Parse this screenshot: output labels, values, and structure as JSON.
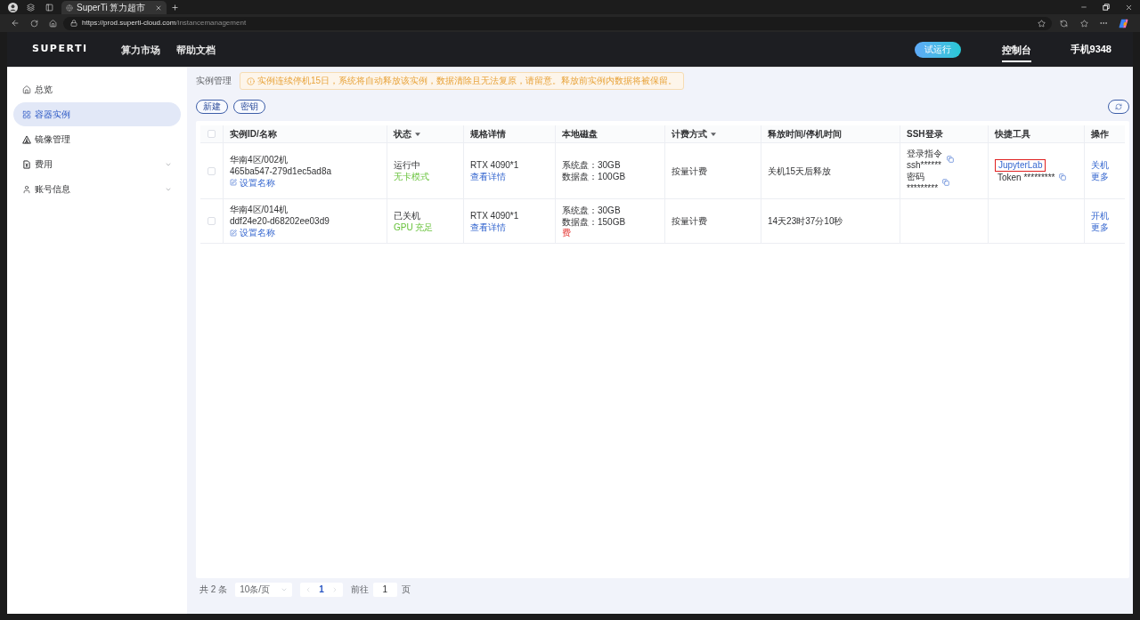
{
  "browser": {
    "tab_title": "SuperTi 算力超市",
    "url_host": "https://prod.superti-cloud.com",
    "url_path": "/instancemanagement"
  },
  "header": {
    "logo": "SUPERTI",
    "nav": [
      {
        "label": "算力市场",
        "selected": false
      },
      {
        "label": "帮助文档",
        "selected": false
      }
    ],
    "trial_button": "试运行",
    "console": {
      "label": "控制台",
      "selected": true
    },
    "account": "手机9348"
  },
  "sidebar": {
    "items": [
      {
        "label": "总览",
        "kind": "link",
        "selected": false
      },
      {
        "label": "容器实例",
        "kind": "link",
        "selected": true
      },
      {
        "label": "镜像管理",
        "kind": "link",
        "selected": false
      },
      {
        "label": "费用",
        "kind": "group",
        "selected": false,
        "expanded": false
      },
      {
        "label": "账号信息",
        "kind": "group",
        "selected": false,
        "expanded": false
      }
    ]
  },
  "page": {
    "breadcrumb": "实例管理",
    "notice": "实例连续停机15日，系统将自动释放该实例，数据清除且无法复原，请留意。释放前实例内数据将被保留。",
    "buttons": [
      "新建",
      "密钥"
    ]
  },
  "table": {
    "all_selected": false,
    "columns": [
      {
        "label": "实例ID/名称",
        "filter": false
      },
      {
        "label": "状态",
        "filter": true
      },
      {
        "label": "规格详情",
        "filter": false
      },
      {
        "label": "本地磁盘",
        "filter": false
      },
      {
        "label": "计费方式",
        "filter": true
      },
      {
        "label": "释放时间/停机时间",
        "filter": false
      },
      {
        "label": "SSH登录",
        "filter": false
      },
      {
        "label": "快捷工具",
        "filter": false
      },
      {
        "label": "操作",
        "filter": false
      }
    ],
    "rows": [
      {
        "selected": false,
        "name": "华南4区/002机",
        "id": "465ba547-279d1ec5ad8a",
        "rename": "设置名称",
        "status": "运行中",
        "status_note": "无卡模式",
        "spec": "RTX 4090*1",
        "spec_link": "查看详情",
        "disk": [
          "系统盘：30GB",
          "数据盘：100GB"
        ],
        "billing": "按量计费",
        "release": "关机15天后释放",
        "ssh": [
          {
            "label": "登录指令",
            "value": "ssh******"
          },
          {
            "label": "密码",
            "value": "*********"
          }
        ],
        "tools": {
          "link": "JupyterLab",
          "highlighted": true,
          "token": "Token *********"
        },
        "actions": [
          "关机",
          "更多"
        ]
      },
      {
        "selected": false,
        "name": "华南4区/014机",
        "id": "ddf24e20-d68202ee03d9",
        "rename": "设置名称",
        "status": "已关机",
        "status_note": "GPU 充足",
        "spec": "RTX 4090*1",
        "spec_link": "查看详情",
        "disk": [
          "系统盘：30GB",
          "数据盘：150GB"
        ],
        "disk_tag": "费",
        "billing": "按量计费",
        "release": "14天23时37分10秒",
        "actions": [
          "开机",
          "更多"
        ]
      }
    ]
  },
  "pagination": {
    "total": "共 2 条",
    "page_size": "10条/页",
    "prev_disabled": true,
    "pages": [
      {
        "label": "1",
        "selected": true
      }
    ],
    "next_disabled": true,
    "goto_label": "前往",
    "goto_value": "1",
    "goto_suffix": "页"
  }
}
